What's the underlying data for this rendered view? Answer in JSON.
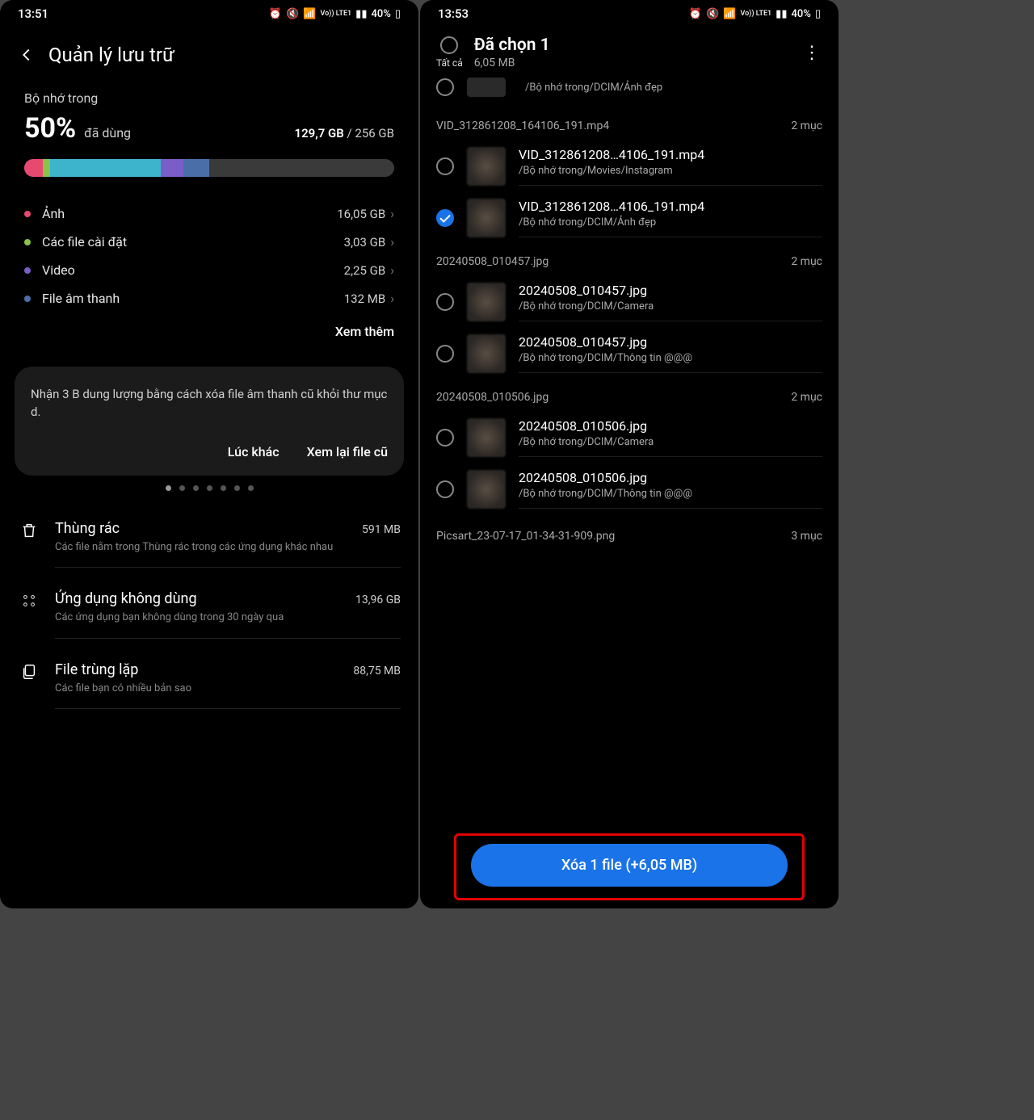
{
  "left": {
    "status": {
      "time": "13:51",
      "battery": "40%",
      "lte": "Vo)) LTE1"
    },
    "header_title": "Quản lý lưu trữ",
    "internal_label": "Bộ nhớ trong",
    "percent": "50%",
    "used_label": "đã dùng",
    "used_gb": "129,7 GB",
    "total_gb": "/ 256 GB",
    "bar_segments": [
      {
        "color": "#e84a6f",
        "w": "5%"
      },
      {
        "color": "#8bc34a",
        "w": "2%"
      },
      {
        "color": "#3db4cc",
        "w": "30%"
      },
      {
        "color": "#7a5ec7",
        "w": "6%"
      },
      {
        "color": "#4a6fa8",
        "w": "7%"
      }
    ],
    "categories": [
      {
        "dot": "#e84a6f",
        "name": "Ảnh",
        "size": "16,05 GB"
      },
      {
        "dot": "#8bc34a",
        "name": "Các file cài đặt",
        "size": "3,03 GB"
      },
      {
        "dot": "#7a5ec7",
        "name": "Video",
        "size": "2,25 GB"
      },
      {
        "dot": "#4a6fa8",
        "name": "File âm thanh",
        "size": "132 MB"
      }
    ],
    "see_more": "Xem thêm",
    "suggestion": {
      "text": "Nhận 3 B dung lượng bằng cách xóa file âm thanh cũ khỏi thư mục d.",
      "later": "Lúc khác",
      "review": "Xem lại file cũ"
    },
    "tools": [
      {
        "icon": "trash",
        "title": "Thùng rác",
        "size": "591 MB",
        "desc": "Các file nằm trong Thùng rác trong các ứng dụng khác nhau"
      },
      {
        "icon": "grid",
        "title": "Ứng dụng không dùng",
        "size": "13,96 GB",
        "desc": "Các ứng dụng bạn không dùng trong 30 ngày qua"
      },
      {
        "icon": "copies",
        "title": "File trùng lặp",
        "size": "88,75 MB",
        "desc": "Các file bạn có nhiều bản sao"
      }
    ]
  },
  "right": {
    "status": {
      "time": "13:53",
      "battery": "40%",
      "lte": "Vo)) LTE1"
    },
    "select_all": "Tất cả",
    "title": "Đã chọn 1",
    "subtitle": "6,05 MB",
    "stub_path": "/Bộ nhớ trong/DCIM/Ảnh đẹp",
    "groups": [
      {
        "name": "VID_312861208_164106_191.mp4",
        "count": "2 mục",
        "files": [
          {
            "checked": false,
            "name": "VID_312861208…4106_191.mp4",
            "path": "/Bộ nhớ trong/Movies/Instagram"
          },
          {
            "checked": true,
            "name": "VID_312861208…4106_191.mp4",
            "path": "/Bộ nhớ trong/DCIM/Ảnh đẹp"
          }
        ]
      },
      {
        "name": "20240508_010457.jpg",
        "count": "2 mục",
        "files": [
          {
            "checked": false,
            "name": "20240508_010457.jpg",
            "path": "/Bộ nhớ trong/DCIM/Camera"
          },
          {
            "checked": false,
            "name": "20240508_010457.jpg",
            "path": "/Bộ nhớ trong/DCIM/Thông tin @@@"
          }
        ]
      },
      {
        "name": "20240508_010506.jpg",
        "count": "2 mục",
        "files": [
          {
            "checked": false,
            "name": "20240508_010506.jpg",
            "path": "/Bộ nhớ trong/DCIM/Camera"
          },
          {
            "checked": false,
            "name": "20240508_010506.jpg",
            "path": "/Bộ nhớ trong/DCIM/Thông tin @@@"
          }
        ]
      }
    ],
    "partial_group": {
      "name": "Picsart_23-07-17_01-34-31-909.png",
      "count": "3 mục"
    },
    "delete_label": "Xóa 1 file (+6,05 MB)"
  }
}
